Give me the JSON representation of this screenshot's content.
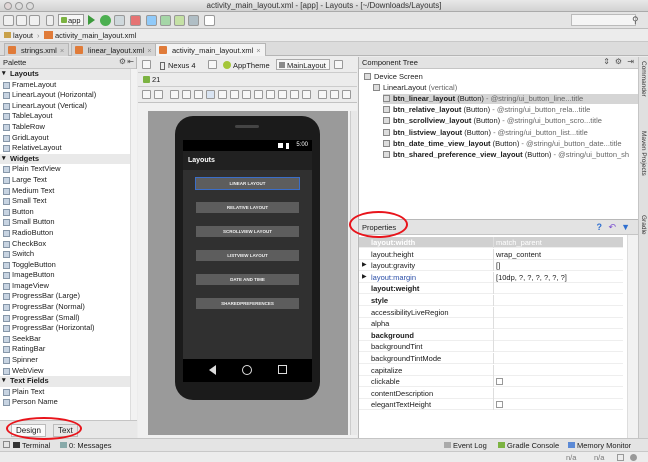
{
  "window": {
    "title": "activity_main_layout.xml - [app] - Layouts - [~/Downloads/Layouts]"
  },
  "toolbar": {
    "run_config": "app"
  },
  "breadcrumb": [
    "Layouts",
    "app",
    "src",
    "main",
    "res",
    "layout",
    "activity_main_layout.xml"
  ],
  "tabs": [
    {
      "label": "strings.xml",
      "active": false
    },
    {
      "label": "linear_layout.xml",
      "active": false
    },
    {
      "label": "activity_main_layout.xml",
      "active": true
    }
  ],
  "palette": {
    "title": "Palette",
    "groups": [
      {
        "name": "Layouts",
        "items": [
          "FrameLayout",
          "LinearLayout (Horizontal)",
          "LinearLayout (Vertical)",
          "TableLayout",
          "TableRow",
          "GridLayout",
          "RelativeLayout"
        ]
      },
      {
        "name": "Widgets",
        "items": [
          "Plain TextView",
          "Large Text",
          "Medium Text",
          "Small Text",
          "Button",
          "Small Button",
          "RadioButton",
          "CheckBox",
          "Switch",
          "ToggleButton",
          "ImageButton",
          "ImageView",
          "ProgressBar (Large)",
          "ProgressBar (Normal)",
          "ProgressBar (Small)",
          "ProgressBar (Horizontal)",
          "SeekBar",
          "RatingBar",
          "Spinner",
          "WebView"
        ]
      },
      {
        "name": "Text Fields",
        "items": [
          "Plain Text",
          "Person Name"
        ]
      }
    ]
  },
  "editor_toolbar": {
    "device": "Nexus 4",
    "theme": "AppTheme",
    "activity": "MainLayout",
    "api": "21"
  },
  "device": {
    "time": "5:00",
    "app_title": "Layouts",
    "buttons": [
      "LINEAR LAYOUT",
      "RELATIVE LAYOUT",
      "SCROLLVIEW LAYOUT",
      "LISTVIEW LAYOUT",
      "DATE AND TIME",
      "SHAREDPREFERENCES"
    ]
  },
  "component_tree": {
    "title": "Component Tree",
    "root": "Device Screen",
    "layout": {
      "name": "LinearLayout",
      "detail": "(vertical)"
    },
    "children": [
      {
        "id": "btn_linear_layout",
        "type": "(Button)",
        "text": "- @string/ui_button_line...title",
        "selected": true
      },
      {
        "id": "btn_relative_layout",
        "type": "(Button)",
        "text": "- @string/ui_button_rela...title",
        "selected": false
      },
      {
        "id": "btn_scrollview_layout",
        "type": "(Button)",
        "text": "- @string/ui_button_scro...title",
        "selected": false
      },
      {
        "id": "btn_listview_layout",
        "type": "(Button)",
        "text": "- @string/ui_button_list...title",
        "selected": false
      },
      {
        "id": "btn_date_time_view_layout",
        "type": "(Button)",
        "text": "- @string/ui_button_date...title",
        "selected": false
      },
      {
        "id": "btn_shared_preference_view_layout",
        "type": "(Button)",
        "text": "- @string/ui_button_sh",
        "selected": false
      }
    ]
  },
  "properties": {
    "title": "Properties",
    "rows": [
      {
        "key": "layout:width",
        "value": "match_parent",
        "bold": true,
        "expand": false
      },
      {
        "key": "layout:height",
        "value": "wrap_content",
        "bold": false,
        "expand": false
      },
      {
        "key": "layout:gravity",
        "value": "[]",
        "bold": false,
        "expand": true
      },
      {
        "key": "layout:margin",
        "value": "[10dp, ?, ?, ?, ?, ?, ?]",
        "bold": false,
        "expand": true,
        "blue": true
      },
      {
        "key": "layout:weight",
        "value": "",
        "bold": true,
        "expand": false
      },
      {
        "key": "style",
        "value": "",
        "bold": true,
        "expand": false
      },
      {
        "key": "accessibilityLiveRegion",
        "value": "",
        "bold": false,
        "expand": false
      },
      {
        "key": "alpha",
        "value": "",
        "bold": false,
        "expand": false
      },
      {
        "key": "background",
        "value": "",
        "bold": true,
        "expand": false
      },
      {
        "key": "backgroundTint",
        "value": "",
        "bold": false,
        "expand": false
      },
      {
        "key": "backgroundTintMode",
        "value": "",
        "bold": false,
        "expand": false
      },
      {
        "key": "capitalize",
        "value": "",
        "bold": false,
        "expand": false
      },
      {
        "key": "clickable",
        "value": "",
        "bold": false,
        "expand": false,
        "checkbox": true
      },
      {
        "key": "contentDescription",
        "value": "",
        "bold": false,
        "expand": false
      },
      {
        "key": "elegantTextHeight",
        "value": "",
        "bold": false,
        "expand": false,
        "checkbox": true
      }
    ]
  },
  "designer_tabs": {
    "design": "Design",
    "text": "Text"
  },
  "tool_windows": {
    "terminal": "Terminal",
    "messages": "0: Messages",
    "event_log": "Event Log",
    "gradle_console": "Gradle Console",
    "memory_monitor": "Memory Monitor"
  },
  "side_tabs": [
    "Commander",
    "Maven Projects",
    "Gradle"
  ],
  "status": {
    "pos1": "n/a",
    "pos2": "n/a"
  }
}
